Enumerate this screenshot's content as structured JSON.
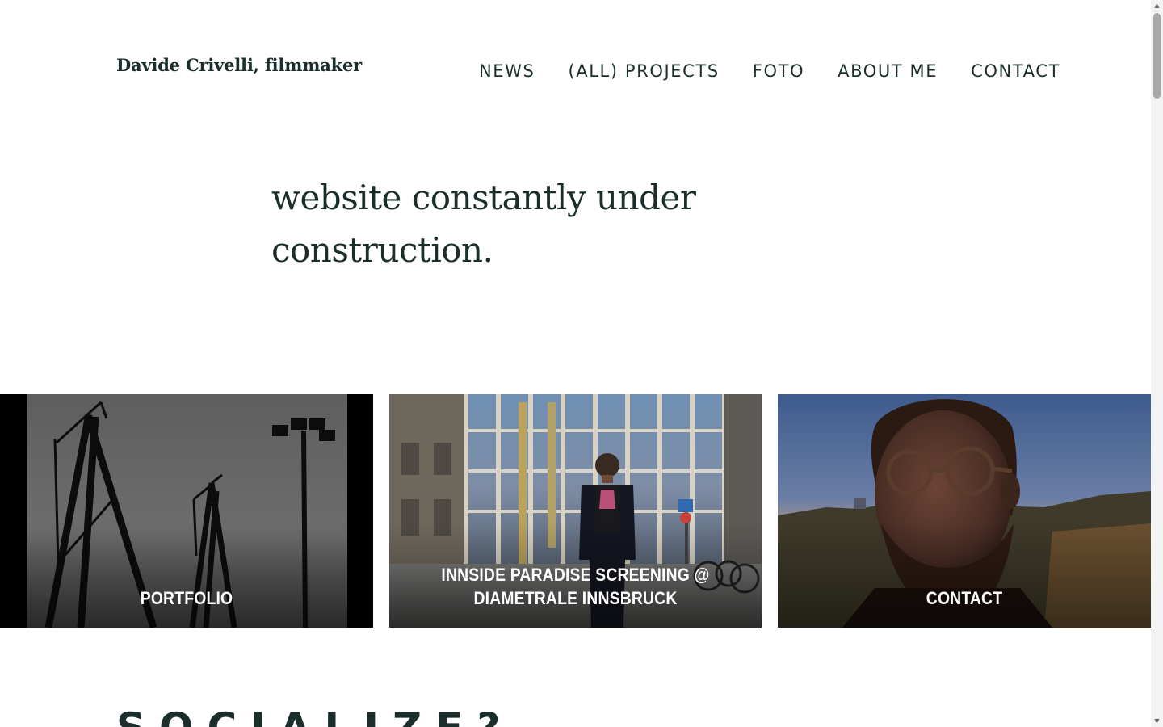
{
  "site": {
    "title": "Davide Crivelli, filmmaker"
  },
  "nav": {
    "items": [
      {
        "label": "NEWS"
      },
      {
        "label": "(ALL) PROJECTS"
      },
      {
        "label": "FOTO"
      },
      {
        "label": "ABOUT ME"
      },
      {
        "label": "CONTACT"
      }
    ]
  },
  "intro": {
    "text": "website constantly under construction."
  },
  "tiles": [
    {
      "label": "PORTFOLIO",
      "image": "cranes-silhouette-photo"
    },
    {
      "label": "INNSIDE PARADISE SCREENING @ DIAMETRALE INNSBRUCK",
      "image": "man-standing-in-street-photo"
    },
    {
      "label": "CONTACT",
      "image": "portrait-at-sunset-photo"
    }
  ],
  "sections": {
    "socialize_heading": "SOCIALIZE?"
  },
  "colors": {
    "text": "#1a2e2b",
    "background": "#ffffff",
    "tile_label": "#ffffff"
  }
}
